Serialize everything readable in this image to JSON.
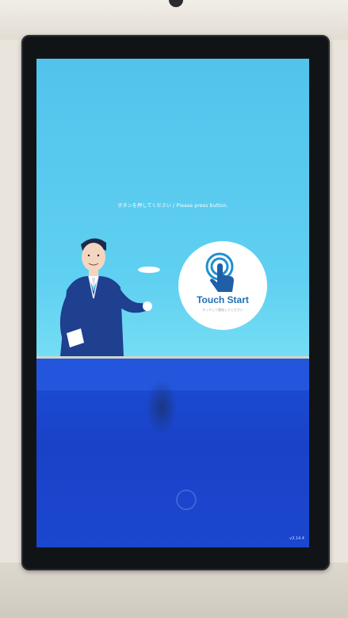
{
  "kiosk": {
    "prompt_text": "ボタンを押してください / Please press button.",
    "touch_button": {
      "label": "Touch Start",
      "sub_label": "タッチして開始してください",
      "icon": "hand-pointer-touch-icon"
    },
    "version": "v3.14.4"
  },
  "colors": {
    "screen_top": "#52c3ec",
    "screen_bottom": "#8ee7f3",
    "panel_blue": "#1b4fd8",
    "touch_text": "#1f6fb4",
    "suit_navy": "#1f3f8f"
  },
  "icons": {
    "attendant": "attendant-illustration",
    "speech": "speech-bubble-icon",
    "brand": "brand-logo-icon"
  }
}
